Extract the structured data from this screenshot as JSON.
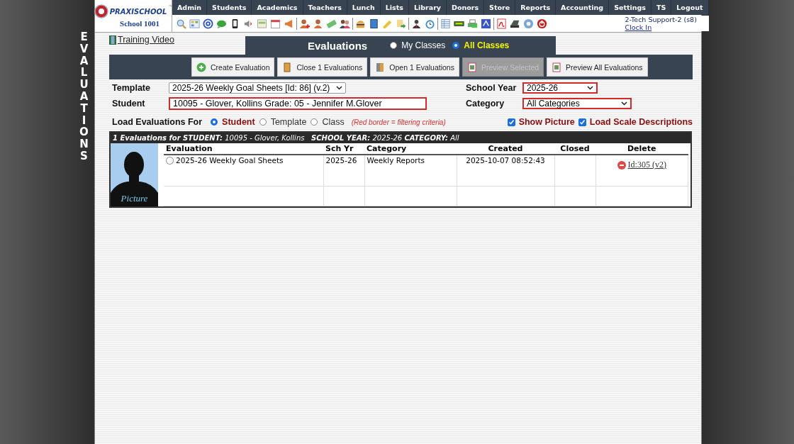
{
  "side_title": "EVALUATIONS",
  "logo": {
    "brand": "PRAXISCHOOL",
    "trademark": "™",
    "school": "School 1001"
  },
  "nav": [
    "Admin",
    "Students",
    "Academics",
    "Teachers",
    "Lunch",
    "Lists",
    "Library",
    "Donors",
    "Store",
    "Reports",
    "Accounting",
    "Settings",
    "TS",
    "Logout"
  ],
  "user": {
    "name": "2-Tech Support-2 (s8)",
    "clock_in": "Clock In"
  },
  "training_video": "Training Video",
  "page_title": "Evaluations",
  "scope": [
    {
      "label": "My Classes",
      "selected": false
    },
    {
      "label": "All Classes",
      "selected": true
    }
  ],
  "actions": [
    {
      "label": "Create Evaluation",
      "kind": "create",
      "disabled": false
    },
    {
      "label": "Close 1 Evaluations",
      "kind": "close",
      "disabled": false
    },
    {
      "label": "Open 1 Evaluations",
      "kind": "open",
      "disabled": false
    },
    {
      "label": "Preview Selected",
      "kind": "preview",
      "disabled": true
    },
    {
      "label": "Preview All Evaluations",
      "kind": "preview",
      "disabled": false
    }
  ],
  "filters": {
    "template": {
      "label": "Template",
      "value": "2025-26 Weekly Goal Sheets [Id: 86] (v.2)",
      "filtering": false
    },
    "student": {
      "label": "Student",
      "value": "10095 - Glover, Kollins Grade: 05 - Jennifer M.Glover",
      "filtering": true
    },
    "school_year": {
      "label": "School Year",
      "value": "2025-26",
      "filtering": true
    },
    "category": {
      "label": "Category",
      "value": "All Categories",
      "filtering": true
    }
  },
  "load_for": {
    "label": "Load Evaluations For",
    "options": [
      {
        "label": "Student",
        "selected": true
      },
      {
        "label": "Template",
        "selected": false
      },
      {
        "label": "Class",
        "selected": false
      }
    ],
    "note": "(Red border = filtering criteria)"
  },
  "options": [
    {
      "label": "Show Picture",
      "checked": true
    },
    {
      "label": "Load Scale Descriptions",
      "checked": true
    }
  ],
  "results": {
    "summary": "**1 Evaluations for STUDENT:** 10095 - Glover, Kollins   **SCHOOL YEAR:** 2025-26 **CATEGORY:** All",
    "picture_label": "Picture",
    "columns": [
      "Evaluation",
      "Sch Yr",
      "Category",
      "Created",
      "Closed",
      "Delete"
    ],
    "rows": [
      {
        "selected": false,
        "evaluation": "2025-26 Weekly Goal Sheets",
        "year": "2025-26",
        "category": "Weekly Reports",
        "created": "2025-10-07 08:52:43",
        "delete": "Id:305 (v2)"
      }
    ]
  }
}
